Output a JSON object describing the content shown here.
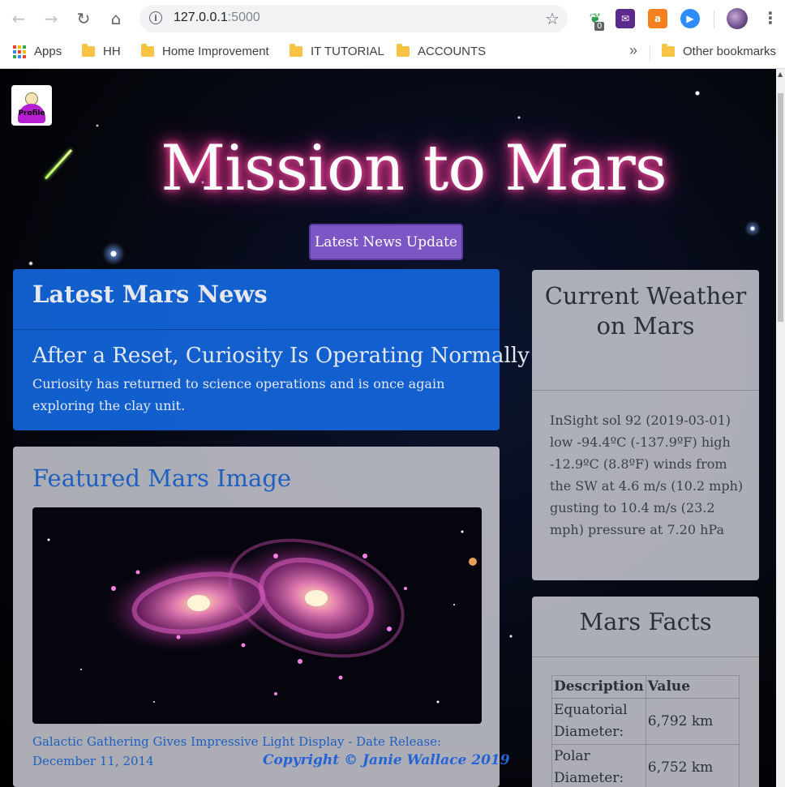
{
  "browser": {
    "url_host": "127.0.0.1",
    "url_port": ":5000",
    "extension_badge": "0",
    "bookmarks": [
      {
        "label": "Apps",
        "type": "apps"
      },
      {
        "label": "HH",
        "type": "folder"
      },
      {
        "label": "Home Improvement",
        "type": "folder"
      },
      {
        "label": "IT TUTORIAL",
        "type": "folder"
      },
      {
        "label": "ACCOUNTS",
        "type": "folder"
      }
    ],
    "overflow_label": "»",
    "other_bookmarks": "Other bookmarks"
  },
  "page": {
    "profile_label": "Profile",
    "title": "Mission to Mars",
    "news_button": "Latest News Update",
    "news": {
      "heading": "Latest Mars News",
      "headline": "After a Reset, Curiosity Is Operating Normally",
      "teaser": "Curiosity has returned to science operations and is once again exploring the clay unit."
    },
    "featured": {
      "heading": "Featured Mars Image",
      "caption": "Galactic Gathering Gives Impressive Light Display - Date Release: December 11, 2014"
    },
    "weather": {
      "heading": "Current Weather on Mars",
      "text": "InSight sol 92 (2019-03-01) low -94.4ºC (-137.9ºF) high -12.9ºC (8.8ºF) winds from the SW at 4.6 m/s (10.2 mph) gusting to 10.4 m/s (23.2 mph) pressure at 7.20 hPa"
    },
    "facts": {
      "heading": "Mars Facts",
      "columns": [
        "Description",
        "Value"
      ],
      "rows": [
        [
          "Equatorial Diameter:",
          "6,792 km"
        ],
        [
          "Polar Diameter:",
          "6,752 km"
        ]
      ]
    },
    "copyright": "Copyright © Janie Wallace 2019"
  },
  "colors": {
    "title_glow": "#ff3c9a",
    "button": "#7b56c4",
    "news_panel": "#146eeb",
    "link_blue": "#1e5fc0"
  }
}
